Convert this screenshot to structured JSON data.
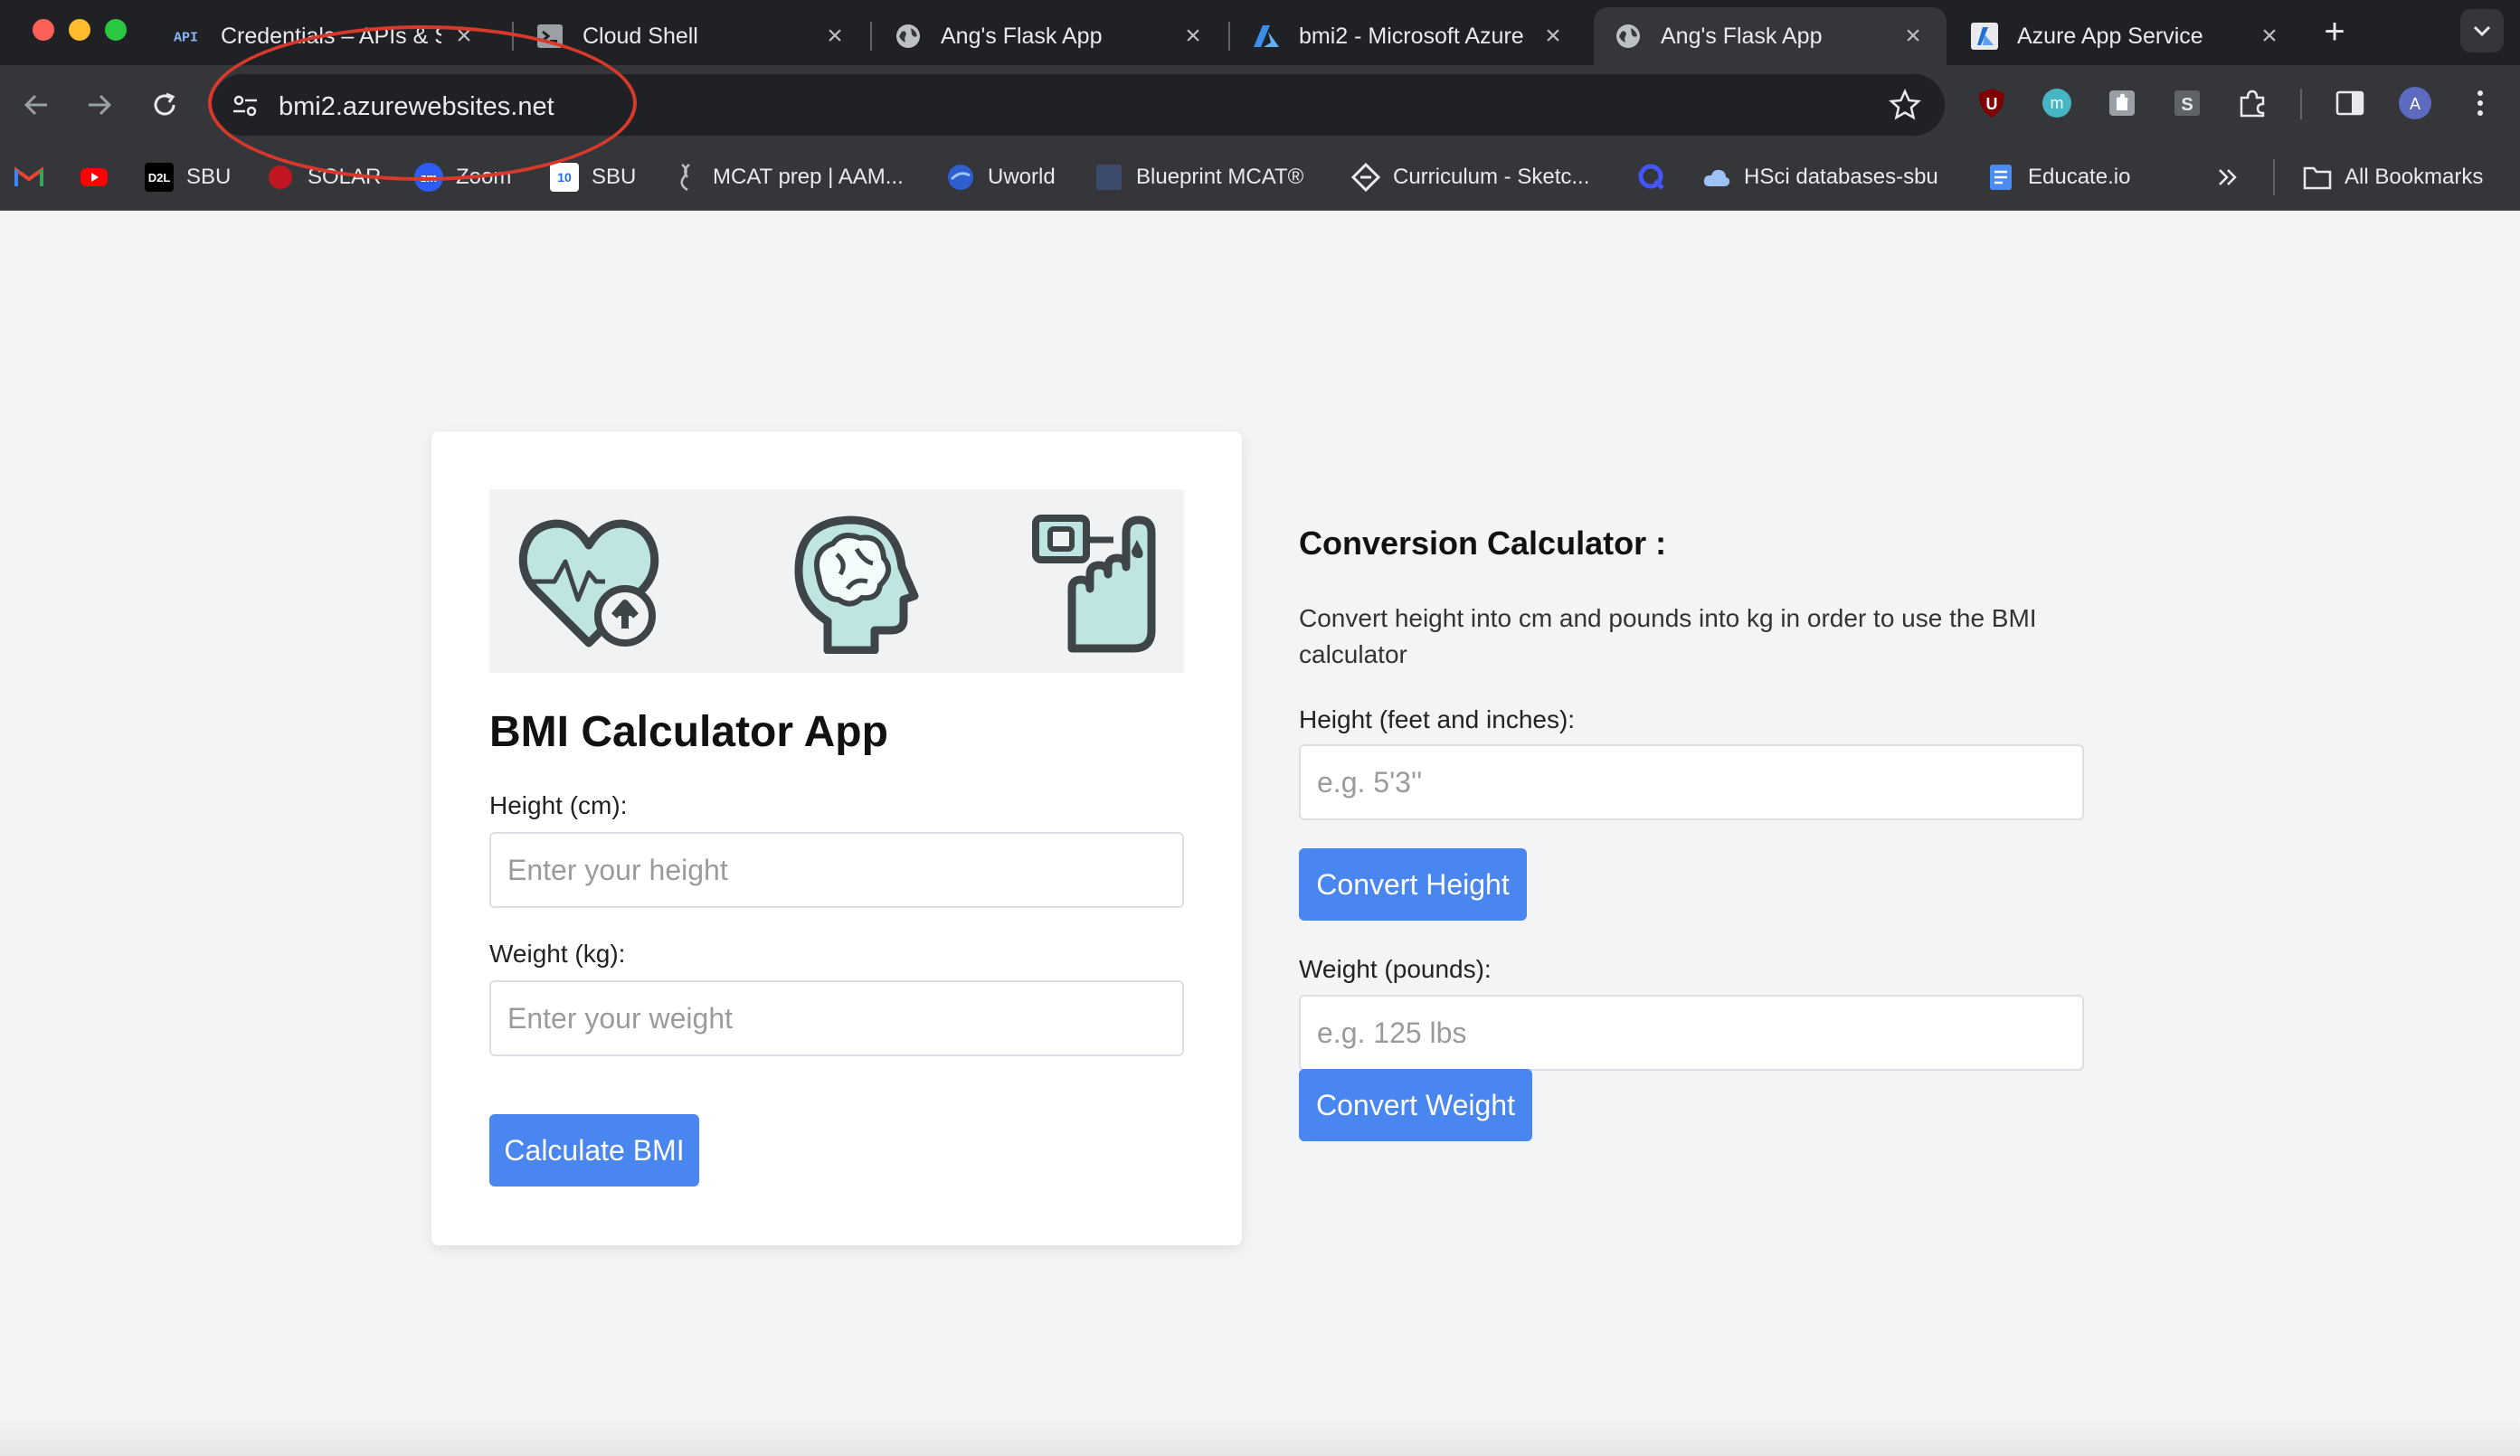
{
  "browser": {
    "tabs": [
      {
        "title": "Credentials – APIs & S",
        "favicon": "api-icon",
        "active": false
      },
      {
        "title": "Cloud Shell",
        "favicon": "terminal-icon",
        "active": false
      },
      {
        "title": "Ang's Flask App",
        "favicon": "globe-icon",
        "active": false
      },
      {
        "title": "bmi2 - Microsoft Azure",
        "favicon": "azure-icon",
        "active": false
      },
      {
        "title": "Ang's Flask App",
        "favicon": "globe-icon",
        "active": true
      },
      {
        "title": "Azure App Service",
        "favicon": "azure-app-service-icon",
        "active": false
      }
    ],
    "address": "bmi2.azurewebsites.net",
    "bookmarks": [
      {
        "label": "",
        "icon": "gmail-icon"
      },
      {
        "label": "",
        "icon": "youtube-icon"
      },
      {
        "label": "SBU",
        "icon": "d2l-icon"
      },
      {
        "label": "SOLAR",
        "icon": "solar-icon"
      },
      {
        "label": "Zoom",
        "icon": "zoom-icon"
      },
      {
        "label": "SBU",
        "icon": "calendar-icon"
      },
      {
        "label": "MCAT prep | AAM...",
        "icon": "aamc-icon"
      },
      {
        "label": "Uworld",
        "icon": "uworld-icon"
      },
      {
        "label": "Blueprint MCAT®",
        "icon": "blueprint-icon"
      },
      {
        "label": "Curriculum - Sketc...",
        "icon": "sketchy-icon"
      },
      {
        "label": "",
        "icon": "quizlet-icon"
      },
      {
        "label": "HSci databases-sbu",
        "icon": "cloud-icon"
      },
      {
        "label": "Educate.io",
        "icon": "educate-icon"
      }
    ],
    "all_bookmarks": "All Bookmarks",
    "annotation_color": "#d8392b"
  },
  "bmi": {
    "title": "BMI Calculator App",
    "height_label": "Height (cm):",
    "height_placeholder": "Enter your height",
    "weight_label": "Weight (kg):",
    "weight_placeholder": "Enter your weight",
    "button": "Calculate BMI"
  },
  "converter": {
    "title": "Conversion Calculator :",
    "description": "Convert height into cm and pounds into kg in order to use the BMI calculator",
    "height_label": "Height (feet and inches):",
    "height_placeholder": "e.g. 5'3''",
    "height_button": "Convert Height",
    "weight_label": "Weight (pounds):",
    "weight_placeholder": "e.g. 125 lbs",
    "weight_button": "Convert Weight"
  },
  "colors": {
    "accent": "#4a86f0",
    "icon_fill": "#bfe5e3",
    "icon_stroke": "#3d4549"
  }
}
